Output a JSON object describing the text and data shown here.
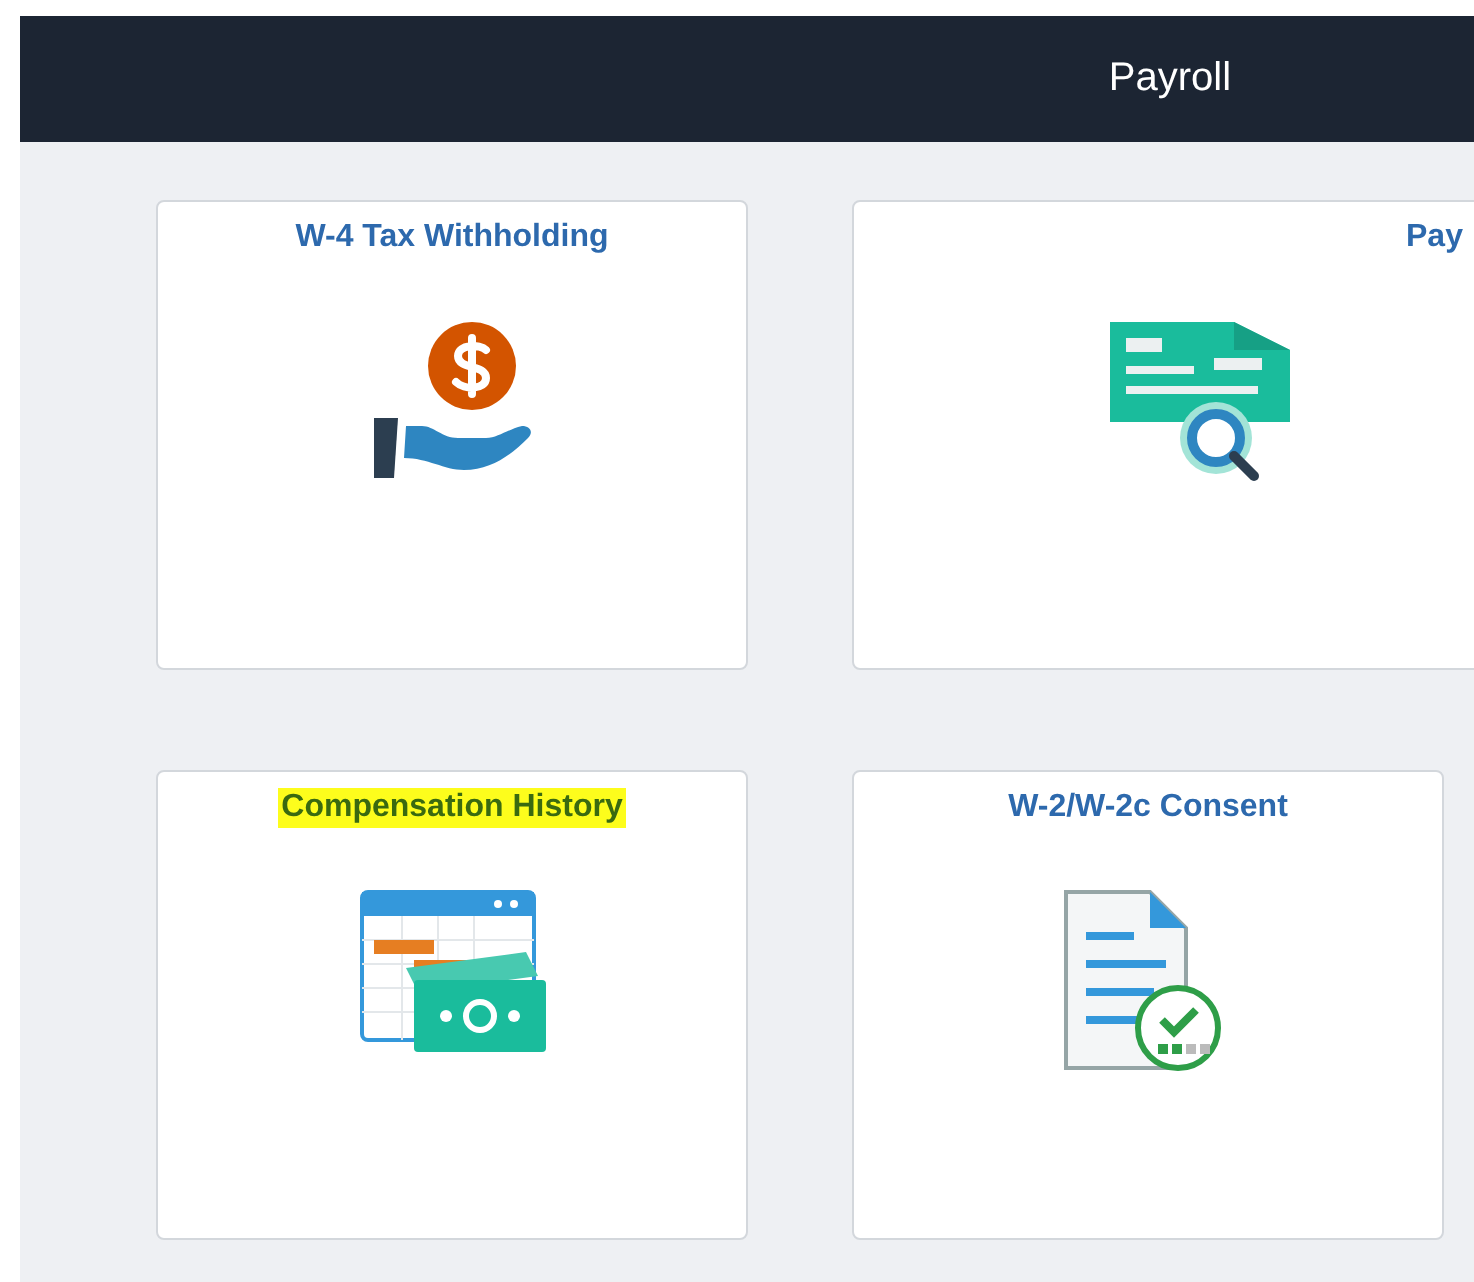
{
  "header": {
    "title": "Payroll"
  },
  "tiles": [
    {
      "title": "W-4 Tax Withholding",
      "kind": "w4",
      "highlighted": false
    },
    {
      "title": "Pay",
      "kind": "paycheck",
      "highlighted": false
    },
    {
      "title": "Compensation History",
      "kind": "compensation",
      "highlighted": true
    },
    {
      "title": "W-2/W-2c Consent",
      "kind": "consent",
      "highlighted": false
    }
  ]
}
